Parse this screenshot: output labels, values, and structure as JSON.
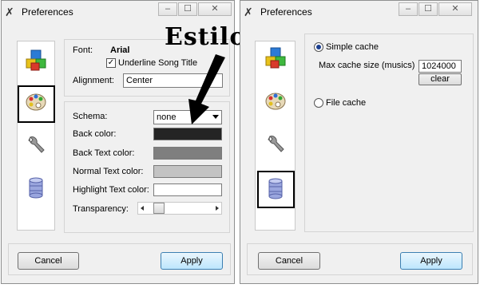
{
  "annotation": {
    "text": "Estilo"
  },
  "left_window": {
    "title": "Preferences",
    "title_icon": "wrench-screwdriver-icon",
    "sidebar": [
      {
        "icon": "cubes-icon",
        "selected": false
      },
      {
        "icon": "palette-icon",
        "selected": true
      },
      {
        "icon": "wrench-icon",
        "selected": false
      },
      {
        "icon": "database-icon",
        "selected": false
      }
    ],
    "font_label": "Font:",
    "font_value": "Arial",
    "underline_label": "Underline Song Title",
    "underline_checked": true,
    "alignment_label": "Alignment:",
    "alignment_value": "Center",
    "schema_label": "Schema:",
    "schema_value": "none",
    "back_color_label": "Back color:",
    "back_text_color_label": "Back Text color:",
    "normal_text_color_label": "Normal Text color:",
    "highlight_text_color_label": "Highlight Text color:",
    "transparency_label": "Transparency:",
    "transparency_value": 0.1,
    "colors": {
      "back": "#242424",
      "back_text": "#7f7f7f",
      "normal_text": "#c3c3c3",
      "highlight_text": "#ffffff"
    },
    "cancel_label": "Cancel",
    "apply_label": "Apply"
  },
  "right_window": {
    "title": "Preferences",
    "title_icon": "wrench-screwdriver-icon",
    "sidebar": [
      {
        "icon": "cubes-icon",
        "selected": false
      },
      {
        "icon": "palette-icon",
        "selected": false
      },
      {
        "icon": "wrench-icon",
        "selected": false
      },
      {
        "icon": "database-icon",
        "selected": true
      }
    ],
    "simple_cache_label": "Simple cache",
    "simple_cache_selected": true,
    "max_cache_label": "Max cache size (musics)",
    "max_cache_value": "1024000",
    "clear_label": "clear",
    "file_cache_label": "File cache",
    "file_cache_selected": false,
    "cancel_label": "Cancel",
    "apply_label": "Apply"
  }
}
